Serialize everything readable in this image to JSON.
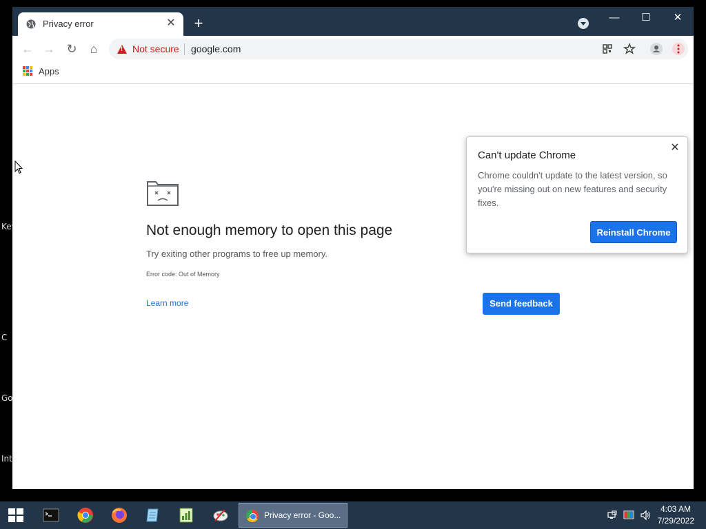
{
  "desktop": {
    "labels": [
      "Key",
      "C",
      "Go",
      "Int"
    ]
  },
  "browser": {
    "tab": {
      "title": "Privacy error",
      "close": "✕"
    },
    "new_tab": "+",
    "window_controls": {
      "minimize": "—",
      "maximize": "☐",
      "close": "✕"
    },
    "toolbar": {
      "back": "←",
      "forward": "→",
      "reload": "↻",
      "home": "⌂",
      "security_label": "Not secure",
      "url": "google.com"
    },
    "bookmarks": {
      "apps_label": "Apps"
    }
  },
  "error_page": {
    "heading": "Not enough memory to open this page",
    "subtext": "Try exiting other programs to free up memory.",
    "error_code": "Error code: Out of Memory",
    "learn_more": "Learn more",
    "send_feedback": "Send feedback"
  },
  "update_popup": {
    "title": "Can't update Chrome",
    "body": "Chrome couldn't update to the latest version, so you're missing out on new features and security fixes.",
    "button": "Reinstall Chrome",
    "close": "✕"
  },
  "taskbar": {
    "active_window_label": "Privacy error - Goo...",
    "time": "4:03 AM",
    "date": "7/29/2022"
  },
  "colors": {
    "frame": "#233548",
    "accent": "#1a73e8",
    "danger": "#c5221f"
  }
}
